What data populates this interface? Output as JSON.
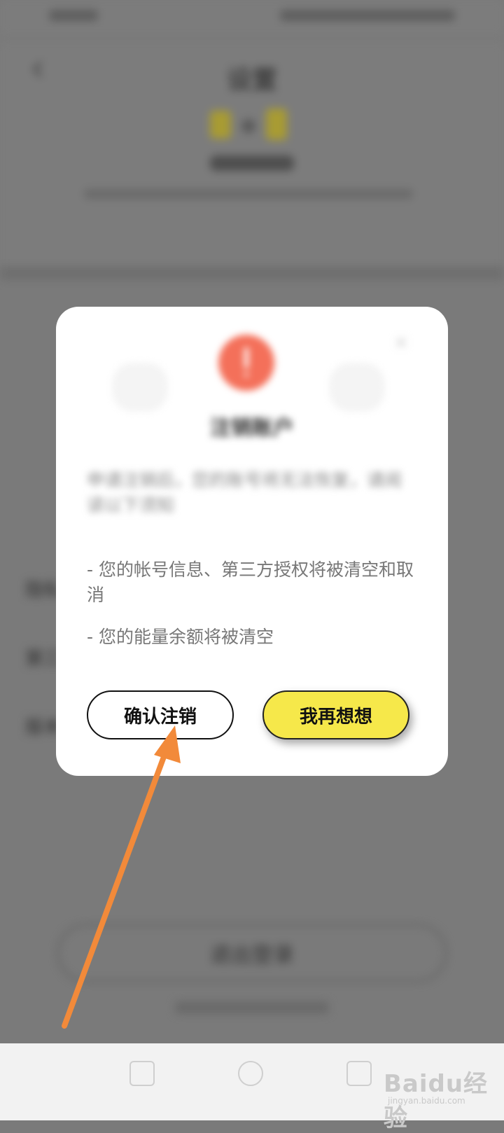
{
  "settings": {
    "title": "设置",
    "list_items": [
      "",
      "",
      "",
      "",
      "隐私",
      "第三",
      "版本"
    ],
    "logout_label": "退出登录"
  },
  "dialog": {
    "title": "注销账户",
    "description": "申请注销后，您的账号将无法恢复，请阅读以下须知",
    "notices": [
      "- 您的帐号信息、第三方授权将被清空和取消",
      "- 您的能量余额将被清空"
    ],
    "confirm_label": "确认注销",
    "cancel_label": "我再想想"
  },
  "watermark": {
    "brand": "Baidu经验",
    "url": "jingyan.baidu.com"
  },
  "colors": {
    "accent": "#f6e84a",
    "warning": "#f4705a",
    "arrow": "#f28a3a"
  },
  "icons": {
    "back": "chevron-left-icon",
    "close": "close-icon",
    "warning": "exclamation-icon"
  }
}
